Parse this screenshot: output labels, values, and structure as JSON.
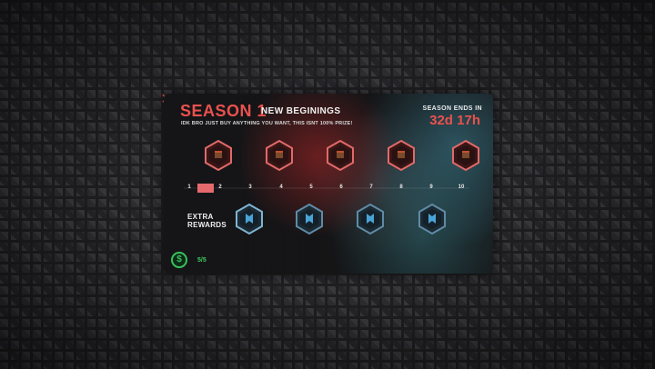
{
  "season": {
    "title": "SEASON 1",
    "subtitle": "NEW BEGININGS",
    "note": "IDK BRO JUST BUY ANYTHING YOU WANT, THIS ISNT 100% PRIZE!",
    "ends_label": "SEASON ENDS IN",
    "ends_value": "32d 17h"
  },
  "close_icon": "close-x-icon",
  "rewards": {
    "main": [
      {
        "icon": "reward-crate-icon",
        "tier": "red"
      },
      {
        "icon": "reward-crate-icon",
        "tier": "red"
      },
      {
        "icon": "reward-crate-icon",
        "tier": "red"
      },
      {
        "icon": "reward-crate-icon",
        "tier": "red"
      },
      {
        "icon": "reward-crate-icon",
        "tier": "red"
      }
    ],
    "extra_label": "EXTRA\nREWARDS",
    "extra": [
      {
        "icon": "reward-banner-icon",
        "tier": "blue"
      },
      {
        "icon": "reward-banner-icon",
        "tier": "blue"
      },
      {
        "icon": "reward-banner-icon",
        "tier": "blue"
      },
      {
        "icon": "reward-banner-icon",
        "tier": "blue"
      }
    ]
  },
  "levels": [
    "1",
    "2",
    "3",
    "4",
    "5",
    "6",
    "7",
    "8",
    "9",
    "10"
  ],
  "progress": {
    "current_level": 1,
    "max_level": 10
  },
  "currency": {
    "icon": "dollar-icon",
    "count": "5/5"
  },
  "colors": {
    "accent": "#e9514f",
    "blue": "#6fb7d6",
    "green": "#37c25c"
  }
}
